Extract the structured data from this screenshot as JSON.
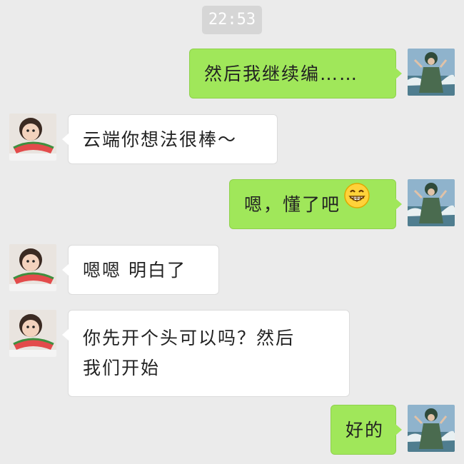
{
  "timestamp": "22:53",
  "messages": [
    {
      "side": "out",
      "text": "然后我继续编……"
    },
    {
      "side": "in",
      "text": "云端你想法很棒～"
    },
    {
      "side": "out",
      "text": "嗯，懂了吧",
      "emoji": "grinning-face-icon"
    },
    {
      "side": "in",
      "text": "嗯嗯 明白了"
    },
    {
      "side": "in",
      "text_line1": "你先开个头可以吗？然后",
      "text_line2": "我们开始"
    },
    {
      "side": "out",
      "text": "好的"
    }
  ],
  "colors": {
    "background": "#ebebeb",
    "outgoing_bubble": "#a0e75a",
    "incoming_bubble": "#ffffff",
    "timestamp_bg": "#d6d6d6"
  },
  "icons": {
    "my_avatar": "woman-at-sea-avatar",
    "other_avatar": "child-eating-watermelon-avatar"
  }
}
